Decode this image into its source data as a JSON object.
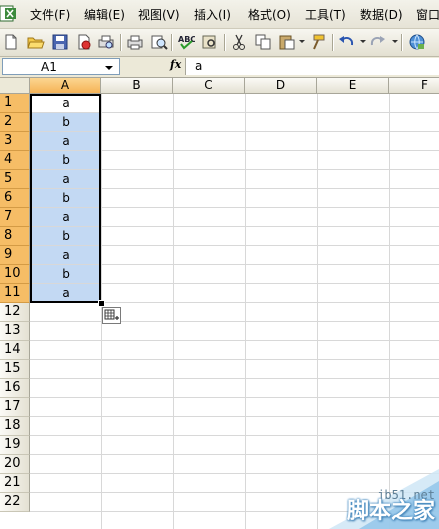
{
  "menubar": {
    "items": [
      "文件(F)",
      "编辑(E)",
      "视图(V)",
      "插入(I)",
      "格式(O)",
      "工具(T)",
      "数据(D)",
      "窗口"
    ]
  },
  "toolbar": {
    "buttons": [
      "new-file",
      "open-folder",
      "save",
      "permission",
      "print-preview",
      "print",
      "spelling",
      "research",
      "cut",
      "copy",
      "paste",
      "format-painter",
      "undo",
      "redo",
      "hyperlink"
    ]
  },
  "formula_bar": {
    "name_box": "A1",
    "fx_label": "fx",
    "content": "a"
  },
  "sheet": {
    "columns": [
      "A",
      "B",
      "C",
      "D",
      "E",
      "F"
    ],
    "rows": [
      "1",
      "2",
      "3",
      "4",
      "5",
      "6",
      "7",
      "8",
      "9",
      "10",
      "11",
      "12",
      "13",
      "14",
      "15",
      "16",
      "17",
      "18",
      "19",
      "20",
      "21",
      "22"
    ],
    "selected_column": "A",
    "selected_rows": [
      "1",
      "2",
      "3",
      "4",
      "5",
      "6",
      "7",
      "8",
      "9",
      "10",
      "11"
    ],
    "column_a_values": [
      "a",
      "b",
      "a",
      "b",
      "a",
      "b",
      "a",
      "b",
      "a",
      "b",
      "a"
    ]
  },
  "colors": {
    "selection_fill": "#c3d9f3",
    "header_selected": "#f6bd66"
  },
  "watermark": {
    "url": "jb51.net",
    "title": "脚本之家"
  }
}
